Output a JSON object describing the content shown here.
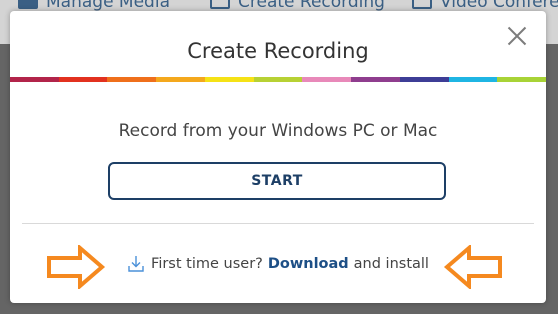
{
  "background_nav": {
    "items": [
      {
        "label": "Manage Media",
        "icon": "media-icon"
      },
      {
        "label": "Create Recording",
        "icon": "recording-icon"
      },
      {
        "label": "Video Conferen",
        "icon": "video-conference-icon"
      }
    ]
  },
  "modal": {
    "title": "Create Recording",
    "close_icon": "close-icon",
    "prompt": "Record from your Windows PC or Mac",
    "start_label": "START",
    "footer": {
      "prefix": "First time user?",
      "link": "Download",
      "suffix": "and install",
      "icon": "download-icon"
    }
  },
  "colors": {
    "accent": "#1d3f66",
    "link": "#1d4f86",
    "annotation_arrow": "#f5891f",
    "rainbow": [
      "#b2244a",
      "#e2311f",
      "#ef6f1b",
      "#f4a81d",
      "#f5e216",
      "#b7d134",
      "#e889b9",
      "#8f3d8e",
      "#3d3d96",
      "#1fb5e3",
      "#a8d336"
    ]
  },
  "annotations": [
    "arrow-right-icon",
    "arrow-left-icon"
  ]
}
